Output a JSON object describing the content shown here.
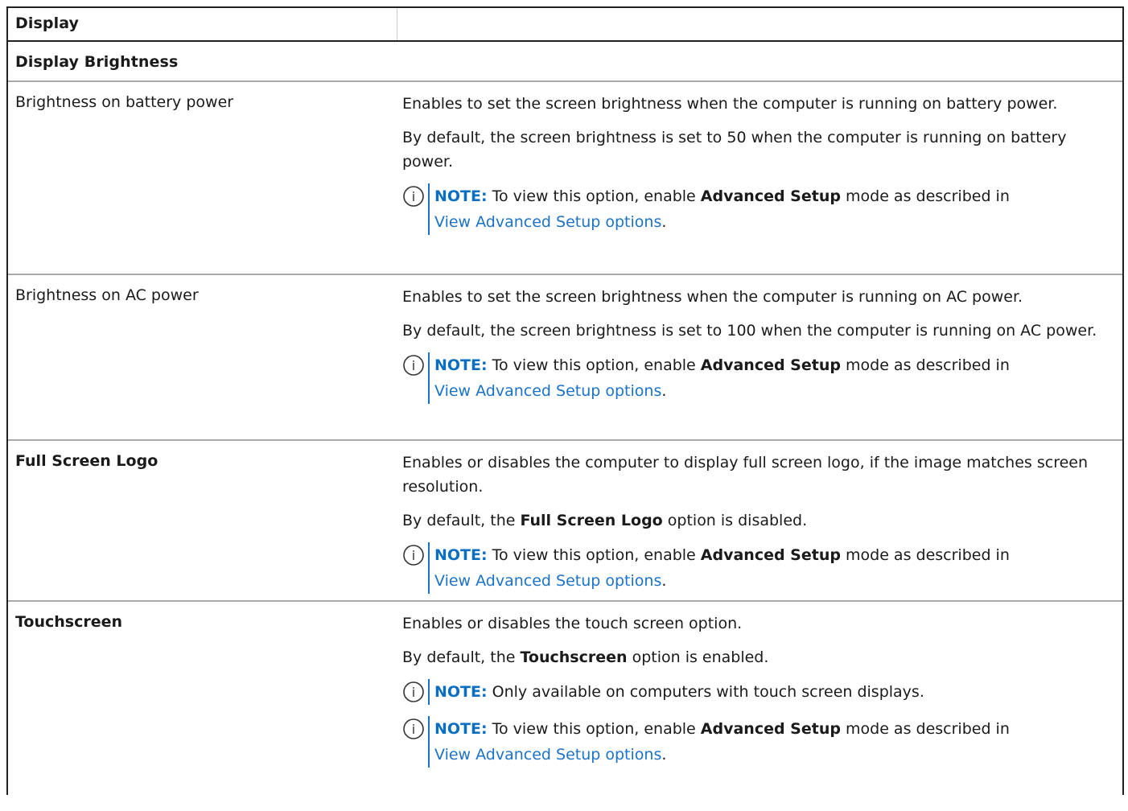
{
  "header": {
    "title": "Display",
    "subtitle": "Display Brightness"
  },
  "rows": [
    {
      "name": "Brightness on battery power",
      "bold": false,
      "desc": "Enables to set the screen brightness when the computer is running on battery power.",
      "default_prefix": "By default, the screen brightness is set to 50 when the computer is running on battery power.",
      "notes": [
        {
          "label": "NOTE:",
          "pre": " To view this option, enable ",
          "strong": "Advanced Setup",
          "post": " mode as described in ",
          "link": "View Advanced Setup options",
          "end": "."
        }
      ]
    },
    {
      "name": "Brightness on AC power",
      "bold": false,
      "desc": "Enables to set the screen brightness when the computer is running on AC power.",
      "default_prefix": "By default, the screen brightness is set to 100 when the computer is running on AC power.",
      "notes": [
        {
          "label": "NOTE:",
          "pre": " To view this option, enable ",
          "strong": "Advanced Setup",
          "post": " mode as described in ",
          "link": "View Advanced Setup options",
          "end": "."
        }
      ]
    },
    {
      "name": "Full Screen Logo",
      "bold": true,
      "desc": "Enables or disables the computer to display full screen logo, if the image matches screen resolution.",
      "default_pre": "By default, the ",
      "default_strong": "Full Screen Logo",
      "default_post": " option is disabled.",
      "notes": [
        {
          "label": "NOTE:",
          "pre": " To view this option, enable ",
          "strong": "Advanced Setup",
          "post": " mode as described in ",
          "link": "View Advanced Setup options",
          "end": "."
        }
      ]
    },
    {
      "name": "Touchscreen",
      "bold": true,
      "desc": "Enables or disables the touch screen option.",
      "default_pre": "By default, the ",
      "default_strong": "Touchscreen",
      "default_post": " option is enabled.",
      "notes": [
        {
          "label": "NOTE:",
          "text": " Only available on computers with touch screen displays."
        },
        {
          "label": "NOTE:",
          "pre": " To view this option, enable ",
          "strong": "Advanced Setup",
          "post": " mode as described in ",
          "link": "View Advanced Setup options",
          "end": "."
        }
      ]
    }
  ],
  "colors": {
    "note_label": "#0a6fc2",
    "link": "#1a73c8",
    "note_bar": "#1a73c8"
  },
  "icons": {
    "note": "info-circle-icon"
  }
}
